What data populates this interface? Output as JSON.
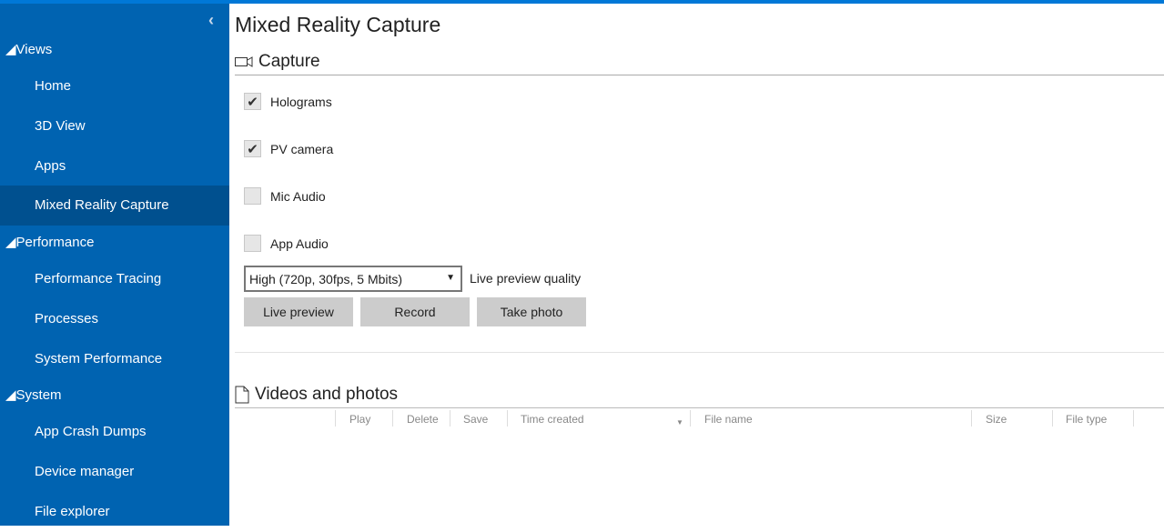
{
  "sidebar": {
    "collapse_icon": "chevron-left-icon",
    "sections": [
      {
        "label": "◢Views",
        "items": [
          "Home",
          "3D View",
          "Apps",
          "Mixed Reality Capture"
        ]
      },
      {
        "label": "◢Performance",
        "items": [
          "Performance Tracing",
          "Processes",
          "System Performance"
        ]
      },
      {
        "label": "◢System",
        "items": [
          "App Crash Dumps",
          "Device manager",
          "File explorer"
        ]
      }
    ],
    "active": "Mixed Reality Capture"
  },
  "main": {
    "title": "Mixed Reality Capture",
    "capture": {
      "heading": "Capture",
      "icon": "video-camera-icon",
      "checkboxes": [
        {
          "label": "Holograms",
          "checked": true
        },
        {
          "label": "PV camera",
          "checked": true
        },
        {
          "label": "Mic Audio",
          "checked": false
        },
        {
          "label": "App Audio",
          "checked": false
        }
      ],
      "quality_value": "High (720p, 30fps, 5 Mbits)",
      "quality_label": "Live preview quality",
      "buttons": [
        "Live preview",
        "Record",
        "Take photo"
      ]
    },
    "videos": {
      "heading": "Videos and photos",
      "icon": "document-icon",
      "columns": [
        "Play",
        "Delete",
        "Save",
        "Time created",
        "File name",
        "Size",
        "File type"
      ]
    }
  }
}
